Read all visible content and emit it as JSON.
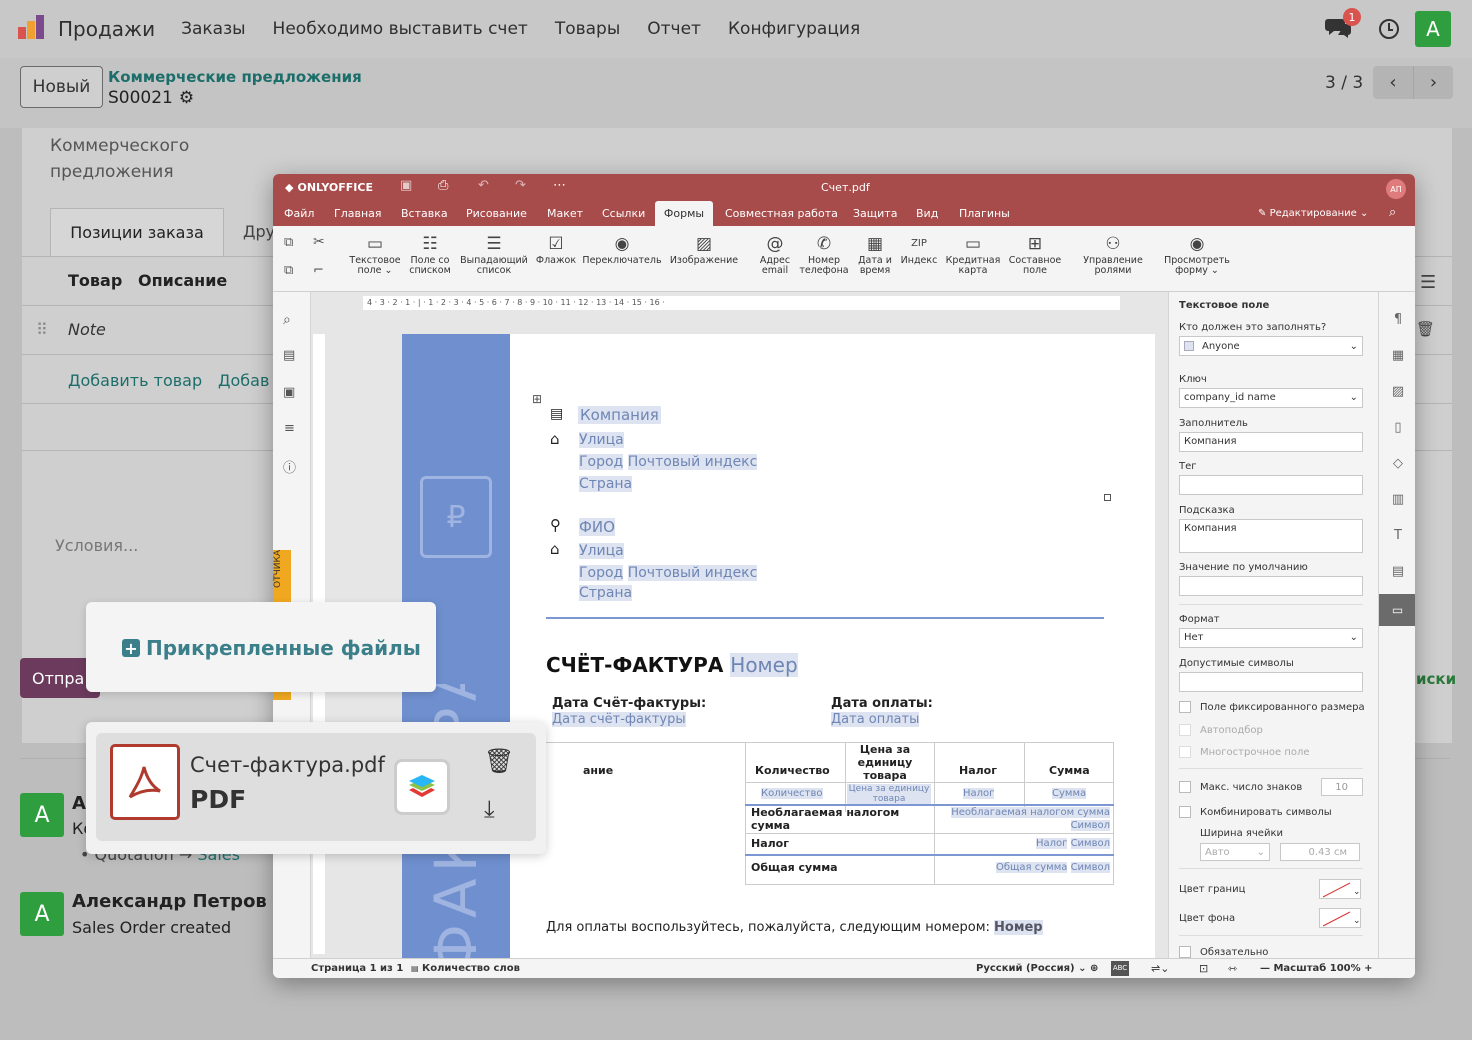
{
  "navbar": {
    "app": "Продажи",
    "menu": [
      "Заказы",
      "Необходимо выставить счет",
      "Товары",
      "Отчет",
      "Конфигурация"
    ],
    "badge": "1",
    "avatar": "A"
  },
  "control": {
    "new_btn": "Новый",
    "breadcrumb_parent": "Коммерческие предложения",
    "breadcrumb_current": "S00021",
    "pager": "3 / 3"
  },
  "form": {
    "label_line1": "Коммерческого",
    "label_line2": "предложения",
    "tabs": [
      "Позиции заказа",
      "Дру"
    ],
    "col_product": "Товар",
    "col_desc": "Описание",
    "note": "Note",
    "add_product": "Добавить товар",
    "add_more": "Добав",
    "terms": "Условия...",
    "send_btn": "Отпра",
    "right_link": "иски"
  },
  "chatter": {
    "entry1": {
      "avatar": "A",
      "name": "А",
      "sub": "Ко",
      "tracking_old": "Quotation",
      "tracking_new": "Sales"
    },
    "entry2": {
      "avatar": "A",
      "name": "Александр Петров -",
      "sub": "Sales Order created"
    }
  },
  "attachments": {
    "title": "Прикрепленные файлы",
    "file_name": "Счет-фактура.pdf",
    "file_type": "PDF"
  },
  "oo": {
    "brand": "ONLYOFFICE",
    "filename": "Счет.pdf",
    "user_initials": "АП",
    "editing": "Редактирование",
    "menu": [
      "Файл",
      "Главная",
      "Вставка",
      "Рисование",
      "Макет",
      "Ссылки",
      "Формы",
      "Совместная работа",
      "Защита",
      "Вид",
      "Плагины"
    ],
    "tools": [
      {
        "l1": "Текстовое",
        "l2": "поле ⌄"
      },
      {
        "l1": "Поле со",
        "l2": "списком"
      },
      {
        "l1": "Выпадающий",
        "l2": "список"
      },
      {
        "l1": "Флажок",
        "l2": ""
      },
      {
        "l1": "Переключатель",
        "l2": ""
      },
      {
        "l1": "Изображение",
        "l2": ""
      },
      {
        "l1": "Адрес",
        "l2": "email"
      },
      {
        "l1": "Номер",
        "l2": "телефона"
      },
      {
        "l1": "Дата и",
        "l2": "время"
      },
      {
        "l1": "Индекс",
        "l2": ""
      },
      {
        "l1": "Кредитная",
        "l2": "карта"
      },
      {
        "l1": "Составное",
        "l2": "поле"
      },
      {
        "l1": "Управление",
        "l2": "ролями"
      },
      {
        "l1": "Просмотреть",
        "l2": "форму ⌄"
      }
    ],
    "ruler": "4 · 3 · 2 · 1 · | · 1 · 2 · 3 · 4 · 5 · 6 · 7 · 8 · 9 · 10 · 11 · 12 · 13 · 14 · 15 · 16 ·",
    "side_tab": "ОТЧИКА",
    "panel": {
      "title": "Текстовое поле",
      "who_label": "Кто должен это заполнять?",
      "who_value": "Anyone",
      "key_label": "Ключ",
      "key_value": "company_id name",
      "placeholder_label": "Заполнитель",
      "placeholder_value": "Компания",
      "tag_label": "Тег",
      "tip_label": "Подсказка",
      "tip_value": "Компания",
      "default_label": "Значение по умолчанию",
      "format_label": "Формат",
      "format_value": "Нет",
      "allowed_label": "Допустимые символы",
      "fixed": "Поле фиксированного размера",
      "autofit": "Автоподбор",
      "multiline": "Многострочное поле",
      "maxchars": "Макс. число знаков",
      "maxchars_val": "10",
      "comb": "Комбинировать символы",
      "cellwidth": "Ширина ячейки",
      "auto": "Авто",
      "cm": "0.43 см",
      "border_color": "Цвет границ",
      "bg_color": "Цвет фона",
      "required": "Обязательно"
    },
    "status": {
      "page": "Страница 1 из 1",
      "words": "Количество слов",
      "lang": "Русский (Россия)",
      "zoom": "Масштаб 100%"
    },
    "doc": {
      "company": "Компания",
      "street": "Улица",
      "city": "Город",
      "zip": "Почтовый индекс",
      "country": "Страна",
      "fio": "ФИО",
      "street2": "Улица",
      "city2": "Город",
      "zip2": "Почтовый индекс",
      "country2": "Страна",
      "invoice_title": "СЧЁТ-ФАКТУРА",
      "number": "Номер",
      "inv_date_label": "Дата Счёт-фактуры:",
      "inv_date": "Дата счёт-фактуры",
      "pay_date_label": "Дата оплаты:",
      "pay_date": "Дата оплаты",
      "th": [
        "ание",
        "Количество",
        "Цена за единицу товара",
        "Налог",
        "Сумма"
      ],
      "tr": [
        "Количество",
        "Цена за единицу товара",
        "Налог",
        "Сумма"
      ],
      "tax_free_label": "Необлагаемая налогом сумма",
      "tax_free_val": "Необлагаемая налогом сумма",
      "symbol": "Символ",
      "tax_label": "Налог",
      "tax_val": "Налог",
      "total_label": "Общая сумма",
      "total_val": "Общая сумма",
      "pay_note": "Для оплаты воспользуйтесь, пожалуйста, следующим номером:",
      "pay_num": "Номер",
      "band_text": "ФАКТУРА"
    }
  }
}
